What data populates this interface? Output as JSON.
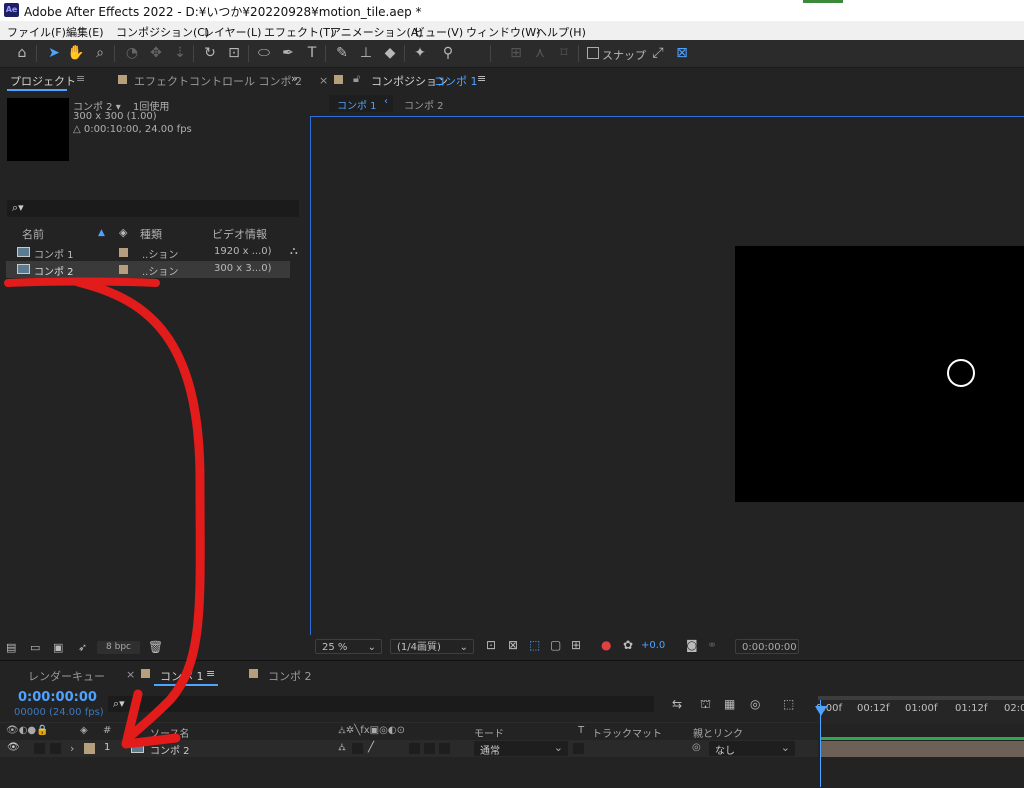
{
  "window": {
    "title": "Adobe After Effects 2022 - D:¥いつか¥20220928¥motion_tile.aep *",
    "app_icon": "Ae"
  },
  "menu": [
    "ファイル(F)",
    "編集(E)",
    "コンポジション(C)",
    "レイヤー(L)",
    "エフェクト(T)",
    "アニメーション(A)",
    "ビュー(V)",
    "ウィンドウ(W)",
    "ヘルプ(H)"
  ],
  "toolbar": {
    "snap_label": "スナップ"
  },
  "project": {
    "tab": "プロジェクト",
    "effect_tab": "エフェクトコントロール コンポ 2",
    "selected_name": "コンポ 2 ▾",
    "usage": "1回使用",
    "dims": "300 x 300 (1.00)",
    "duration": "△ 0:00:10:00, 24.00 fps",
    "columns": {
      "name": "名前",
      "type": "種類",
      "video": "ビデオ情報"
    },
    "items": [
      {
        "name": "コンポ 1",
        "type": "..ション",
        "video": "1920 x ...0)"
      },
      {
        "name": "コンポ 2",
        "type": "..ション",
        "video": "300 x 3...0)"
      }
    ],
    "bpc": "8 bpc"
  },
  "viewer": {
    "tab_prefix": "コンポジション",
    "tab_comp": "コンポ 1",
    "breadcrumb": [
      "コンポ 1",
      "コンポ 2"
    ],
    "zoom": "25 %",
    "resolution": "(1/4画質)",
    "exposure": "+0.0",
    "timecode": "0:00:00:00"
  },
  "timeline": {
    "render_tab": "レンダーキュー",
    "comp_tab": "コンポ 1",
    "comp_tab2": "コンポ 2",
    "timecode": "0:00:00:00",
    "fps": "00000 (24.00 fps)",
    "hdr_num": "#",
    "hdr_source": "ソース名",
    "hdr_mode": "モード",
    "hdr_t": "T",
    "hdr_trackmatte": "トラックマット",
    "hdr_parent": "親とリンク",
    "layer": {
      "index": "1",
      "name": "コンポ 2",
      "mode": "通常",
      "parent": "なし"
    },
    "ruler": [
      "0:00f",
      "00:12f",
      "01:00f",
      "01:12f",
      "02:0"
    ]
  },
  "colors": {
    "accent": "#4da3ff",
    "annotation": "#e21b1b",
    "label_swatch": "#b59f7d"
  }
}
